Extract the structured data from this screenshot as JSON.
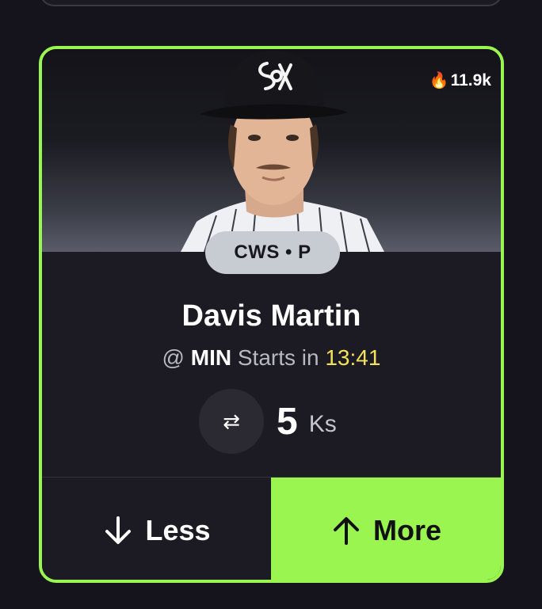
{
  "card": {
    "popularity": "11.9k",
    "team_position": "CWS • P",
    "player_name": "Davis Martin",
    "matchup_prefix": "@",
    "opponent": "MIN",
    "starts_label": "Starts in",
    "countdown": "13:41",
    "line_value": "5",
    "stat_label": "Ks",
    "less_label": "Less",
    "more_label": "More"
  },
  "icons": {
    "popularity": "flame-icon",
    "swap": "swap-arrows-icon",
    "less": "arrow-down-icon",
    "more": "arrow-up-icon"
  },
  "colors": {
    "accent": "#9af550",
    "countdown": "#f2e15a",
    "background": "#15141c",
    "card": "#1c1b23"
  }
}
